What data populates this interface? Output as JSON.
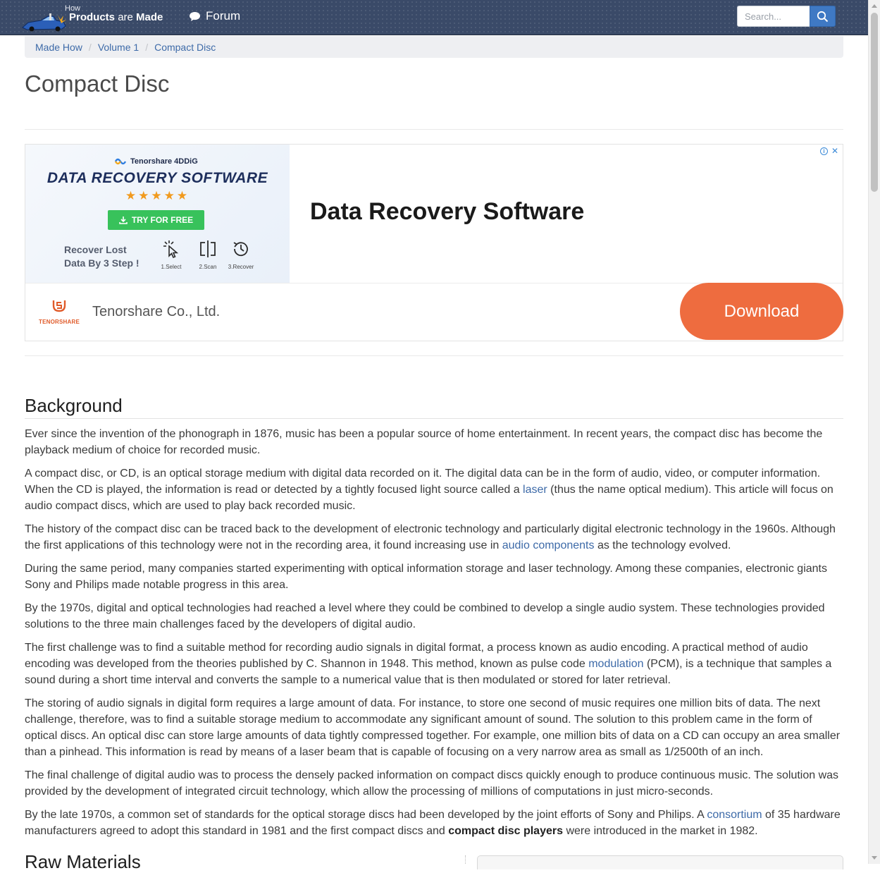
{
  "header": {
    "logo_how": "How",
    "logo_products": "Products",
    "logo_are": "are",
    "logo_made": "Made",
    "forum_label": "Forum",
    "search_placeholder": "Search..."
  },
  "breadcrumb": [
    "Made How",
    "Volume 1",
    "Compact Disc"
  ],
  "page_title": "Compact Disc",
  "ad": {
    "brand": "Tenorshare 4DDiG",
    "headline": "DATA RECOVERY SOFTWARE",
    "stars": "★★★★★",
    "try_label": "TRY FOR FREE",
    "recover_text": "Recover Lost\nData By 3 Step !",
    "steps": [
      "1.Select",
      "2.Scan",
      "3.Recover"
    ],
    "main_headline": "Data Recovery Software",
    "company_logo_text": "TENORSHARE",
    "company": "Tenorshare Co., Ltd.",
    "download_label": "Download",
    "info_icon": "ⓘ",
    "close_icon": "✕"
  },
  "article": {
    "section_background": "Background",
    "section_raw_materials": "Raw Materials",
    "p1": "Ever since the invention of the phonograph in 1876, music has been a popular source of home entertainment. In recent years, the compact disc has become the playback medium of choice for recorded music.",
    "p2_a": "A compact disc, or CD, is an optical storage medium with digital data recorded on it. The digital data can be in the form of audio, video, or computer information. When the CD is played, the information is read or detected by a tightly focused light source called a ",
    "p2_link": "laser",
    "p2_b": " (thus the name optical medium). This article will focus on audio compact discs, which are used to play back recorded music.",
    "p3_a": "The history of the compact disc can be traced back to the development of electronic technology and particularly digital electronic technology in the 1960s. Although the first applications of this technology were not in the recording area, it found increasing use in ",
    "p3_link": "audio components",
    "p3_b": " as the technology evolved.",
    "p4": "During the same period, many companies started experimenting with optical information storage and laser technology. Among these companies, electronic giants Sony and Philips made notable progress in this area.",
    "p5": "By the 1970s, digital and optical technologies had reached a level where they could be combined to develop a single audio system. These technologies provided solutions to the three main challenges faced by the developers of digital audio.",
    "p6_a": "The first challenge was to find a suitable method for recording audio signals in digital format, a process known as audio encoding. A practical method of audio encoding was developed from the theories published by C. Shannon in 1948. This method, known as pulse code ",
    "p6_link": "modulation",
    "p6_b": " (PCM), is a technique that samples a sound during a short time interval and converts the sample to a numerical value that is then modulated or stored for later retrieval.",
    "p7": "The storing of audio signals in digital form requires a large amount of data. For instance, to store one second of music requires one million bits of data. The next challenge, therefore, was to find a suitable storage medium to accommodate any significant amount of sound. The solution to this problem came in the form of optical discs. An optical disc can store large amounts of data tightly compressed together. For example, one million bits of data on a CD can occupy an area smaller than a pinhead. This information is read by means of a laser beam that is capable of focusing on a very narrow area as small as 1/2500th of an inch.",
    "p8": "The final challenge of digital audio was to process the densely packed information on compact discs quickly enough to produce continuous music. The solution was provided by the development of integrated circuit technology, which allow the processing of millions of computations in just micro-seconds.",
    "p9_a": "By the late 1970s, a common set of standards for the optical storage discs had been developed by the joint efforts of Sony and Philips. A ",
    "p9_link": "consortium",
    "p9_b": " of 35 hardware manufacturers agreed to adopt this standard in 1981 and the first compact discs and ",
    "p9_strong": "compact disc players",
    "p9_c": " were introduced in the market in 1982."
  }
}
